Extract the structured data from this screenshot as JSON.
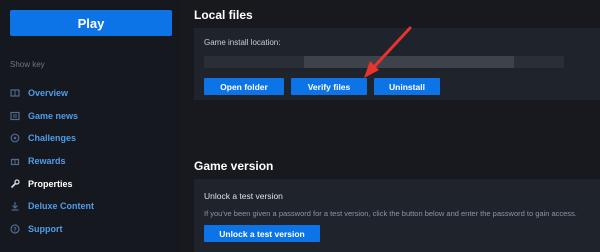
{
  "sidebar": {
    "play_label": "Play",
    "show_key_label": "Show key",
    "items": [
      {
        "label": "Overview",
        "icon": "book-icon"
      },
      {
        "label": "Game news",
        "icon": "news-icon"
      },
      {
        "label": "Challenges",
        "icon": "target-icon"
      },
      {
        "label": "Rewards",
        "icon": "gift-icon"
      },
      {
        "label": "Properties",
        "icon": "wrench-icon",
        "active": true
      },
      {
        "label": "Deluxe Content",
        "icon": "download-icon"
      },
      {
        "label": "Support",
        "icon": "help-icon"
      }
    ]
  },
  "local_files": {
    "title": "Local files",
    "install_label": "Game install location:",
    "open_folder": "Open folder",
    "verify_files": "Verify files",
    "uninstall": "Uninstall"
  },
  "game_version": {
    "title": "Game version",
    "unlock_heading": "Unlock a test version",
    "help_text": "If you've been given a password for a test version, click the button below and enter the password to gain access.",
    "unlock_button": "Unlock a test version"
  },
  "colors": {
    "accent": "#0d74e7",
    "arrow": "#e8332f"
  }
}
